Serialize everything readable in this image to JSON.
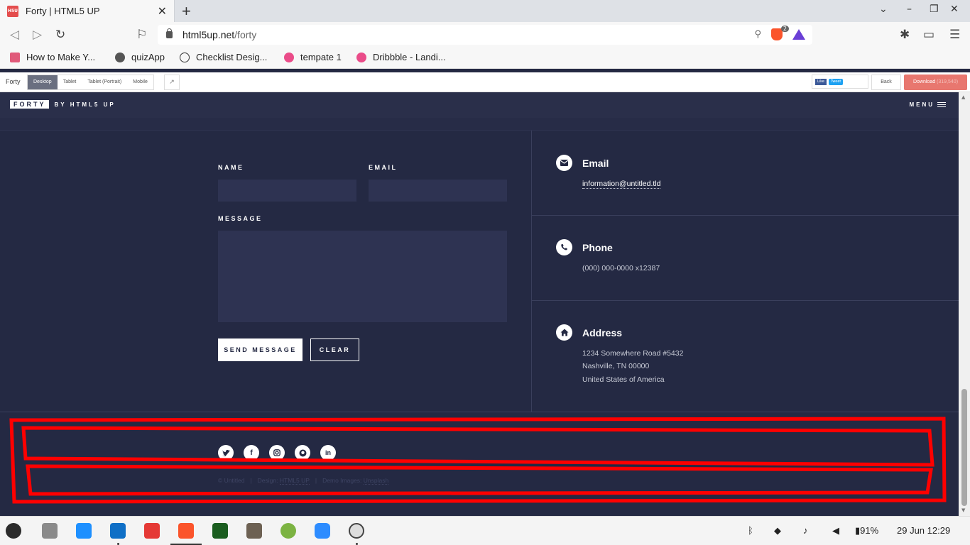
{
  "browser": {
    "tab_title": "Forty | HTML5 UP",
    "favicon_text": "H5U",
    "url_domain": "html5up.net",
    "url_path": "/forty",
    "brave_badge": "2",
    "bookmarks": [
      {
        "label": "How to Make Y...",
        "color": "#e05a7a"
      },
      {
        "label": "quizApp",
        "color": "#555555"
      },
      {
        "label": "Checklist Desig...",
        "color": "#333333"
      },
      {
        "label": "tempate 1",
        "color": "#ea4c89"
      },
      {
        "label": "Dribbble - Landi...",
        "color": "#ea4c89"
      }
    ]
  },
  "demo_bar": {
    "title": "Forty",
    "devices": [
      "Desktop",
      "Tablet",
      "Tablet (Portrait)",
      "Mobile"
    ],
    "active_device": "Desktop",
    "like_label": "Like",
    "tweet_label": "Tweet",
    "back_label": "Back",
    "download_label": "Download",
    "download_count": "(319,540)"
  },
  "site": {
    "logo": "FORTY",
    "logo_by": "BY HTML5 UP",
    "menu_label": "MENU"
  },
  "form": {
    "name_label": "NAME",
    "email_label": "EMAIL",
    "message_label": "MESSAGE",
    "send_label": "SEND MESSAGE",
    "clear_label": "CLEAR"
  },
  "contact": {
    "email_title": "Email",
    "email_value": "information@untitled.tld",
    "phone_title": "Phone",
    "phone_value": "(000) 000-0000 x12387",
    "address_title": "Address",
    "address_line1": "1234 Somewhere Road #5432",
    "address_line2": "Nashville, TN 00000",
    "address_line3": "United States of America"
  },
  "footer": {
    "social_icons": [
      "twitter-icon",
      "facebook-icon",
      "instagram-icon",
      "github-icon",
      "linkedin-icon"
    ],
    "copyright": "© Untitled",
    "design_label": "Design:",
    "design_link": "HTML5 UP",
    "images_label": "Demo Images:",
    "images_link": "Unsplash"
  },
  "taskbar": {
    "battery": "91%",
    "datetime": "29 Jun 12:29"
  },
  "colors": {
    "page_bg": "#242943",
    "annotation": "#ff0000",
    "download_btn": "#e8776f"
  }
}
